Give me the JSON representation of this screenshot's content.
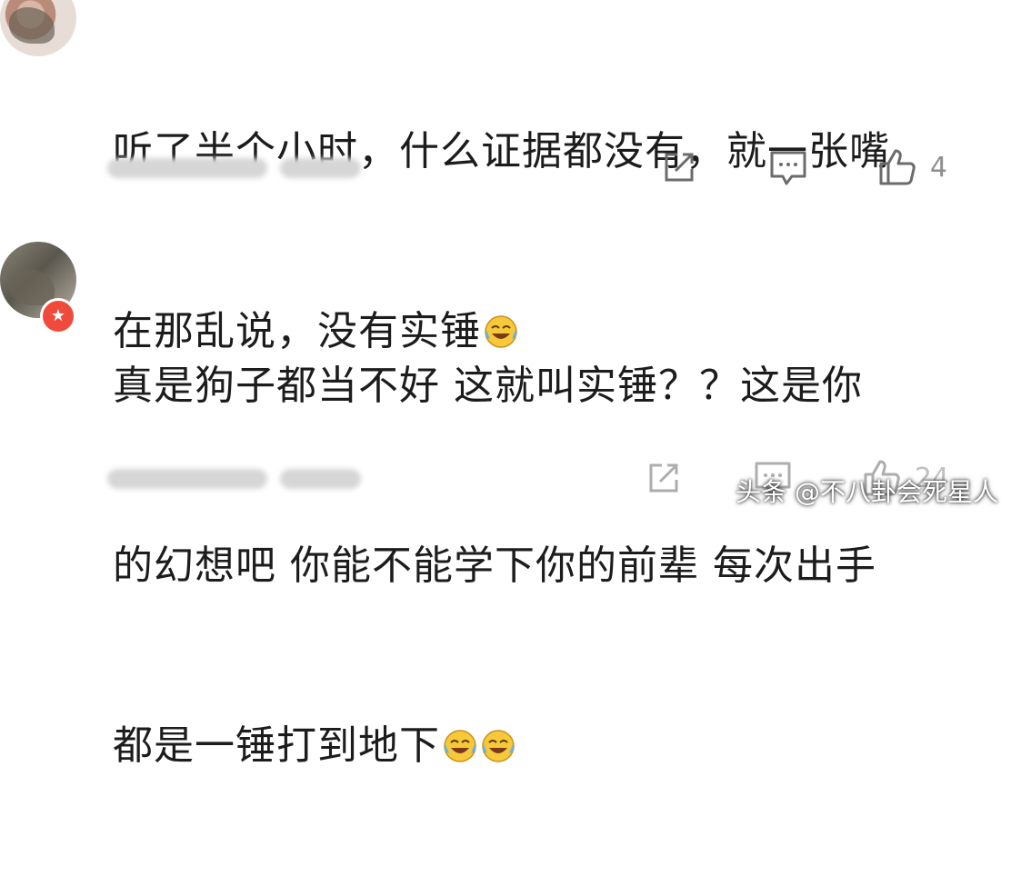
{
  "comments": [
    {
      "text_lines": [
        "听了半个小时，什么证据都没有，就一张嘴",
        "在那乱说，没有实锤"
      ],
      "emoji_count": 1,
      "meta_blurred": [
        "████ ██ ██:██",
        "█████"
      ],
      "actions": {
        "share_icon": "share-icon",
        "reply_icon": "comment-icon",
        "like_icon": "thumbs-up-icon",
        "like_count": "4"
      },
      "verified": false
    },
    {
      "text_lines": [
        "真是狗子都当不好 这就叫实锤？？这是你",
        "的幻想吧 你能不能学下你的前辈 每次出手",
        "都是一锤打到地下"
      ],
      "emoji_count": 2,
      "meta_blurred": [
        "████ ██ ██:██",
        "█████"
      ],
      "actions": {
        "share_icon": "share-icon",
        "reply_icon": "comment-icon",
        "like_icon": "thumbs-up-icon",
        "like_count": "24"
      },
      "verified": true
    }
  ],
  "watermark": "头条 @不八卦会死星人",
  "colors": {
    "text": "#1c1c1c",
    "icon": "#6b6b6b",
    "badge": "#f04a3c"
  }
}
